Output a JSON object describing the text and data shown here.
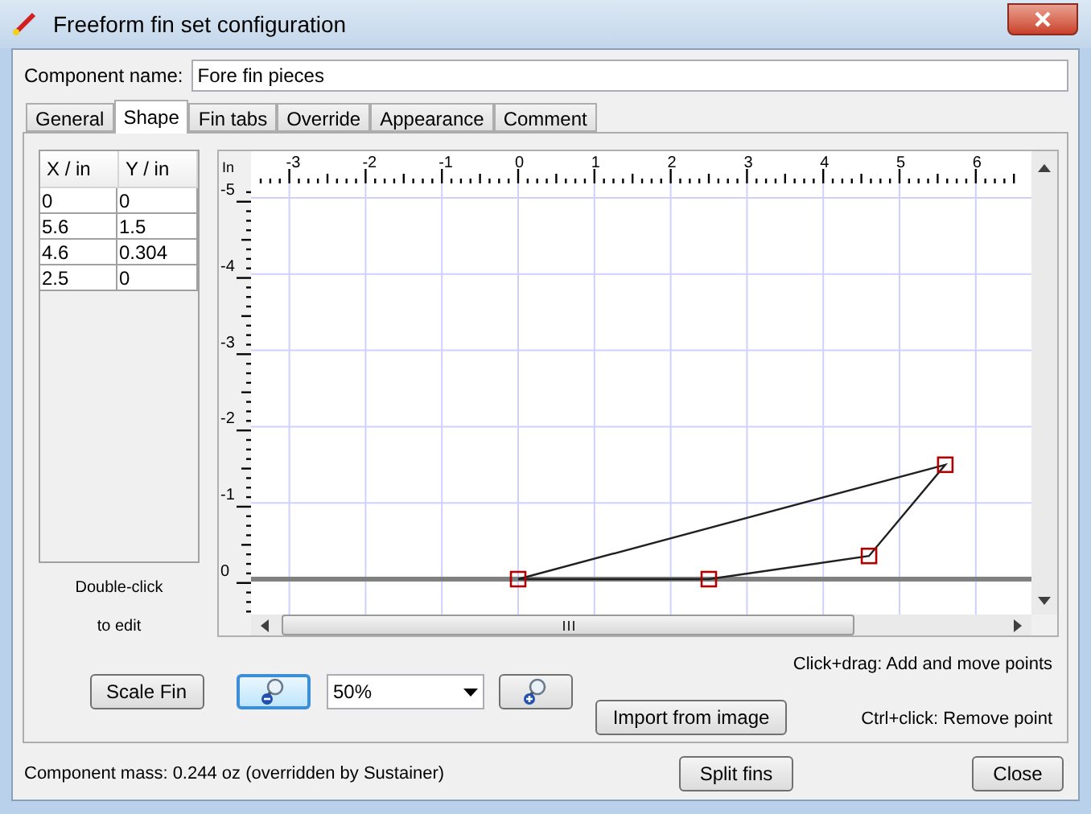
{
  "window": {
    "title": "Freeform fin set configuration"
  },
  "component_name": {
    "label": "Component name:",
    "value": "Fore fin pieces"
  },
  "tabs": [
    {
      "label": "General",
      "selected": false
    },
    {
      "label": "Shape",
      "selected": true
    },
    {
      "label": "Fin tabs",
      "selected": false
    },
    {
      "label": "Override",
      "selected": false
    },
    {
      "label": "Appearance",
      "selected": false
    },
    {
      "label": "Comment",
      "selected": false
    }
  ],
  "points_table": {
    "columns": [
      "X / in",
      "Y / in"
    ],
    "rows": [
      [
        "0",
        "0"
      ],
      [
        "5.6",
        "1.5"
      ],
      [
        "4.6",
        "0.304"
      ],
      [
        "2.5",
        "0"
      ]
    ],
    "hint": [
      "Double-click",
      "to edit"
    ]
  },
  "editor": {
    "unit": "In",
    "x_ruler": [
      "-3",
      "-2",
      "-1",
      "0",
      "1",
      "2",
      "3",
      "4",
      "5",
      "6"
    ],
    "y_ruler": [
      "-5",
      "-4",
      "-3",
      "-2",
      "-1",
      "0"
    ]
  },
  "scale_button": "Scale Fin",
  "zoom": {
    "buttons": [
      {
        "kind": "zoom-out",
        "focused": true
      },
      {
        "kind": "zoom-in",
        "focused": false
      }
    ],
    "value": "50%"
  },
  "import_button": "Import from image",
  "instructions": [
    "Click+drag: Add and move points",
    "Ctrl+click: Remove point"
  ],
  "status": "Component mass: 0.244 oz (overridden by Sustainer)",
  "footer_buttons": [
    "Split fins",
    "Close"
  ]
}
